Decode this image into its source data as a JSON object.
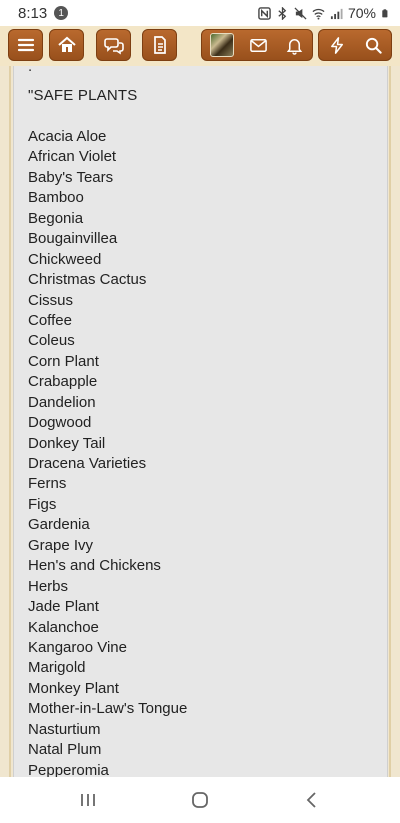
{
  "status_bar": {
    "time": "8:13",
    "notification_count": "1",
    "battery_percent": "70%",
    "icons": [
      "nfc-icon",
      "bluetooth-icon",
      "mute-icon",
      "wifi-icon",
      "signal-icon",
      "battery-icon"
    ]
  },
  "toolbar": {
    "left_buttons": [
      "menu-icon",
      "home-icon",
      "chat-icon",
      "document-icon"
    ],
    "right_buttons": [
      "avatar",
      "mail-icon",
      "bell-icon",
      "lightning-icon",
      "search-icon"
    ],
    "accent_color": "#a85b24",
    "background_color": "#f3e6c7"
  },
  "post": {
    "heading": "\"SAFE PLANTS",
    "top_fragment": ".",
    "plants": [
      "Acacia Aloe",
      "African Violet",
      "Baby's Tears",
      "Bamboo",
      "Begonia",
      "Bougainvillea",
      "Chickweed",
      "Christmas Cactus",
      "Cissus",
      "Coffee",
      "Coleus",
      "Corn Plant",
      "Crabapple",
      "Dandelion",
      "Dogwood",
      "Donkey Tail",
      "Dracena Varieties",
      "Ferns",
      "Figs",
      "Gardenia",
      "Grape Ivy",
      "Hen's and Chickens",
      "Herbs",
      "Jade Plant",
      "Kalanchoe",
      "Kangaroo Vine",
      "Marigold",
      "Monkey Plant",
      "Mother-in-Law's Tongue",
      "Nasturtium",
      "Natal Plum",
      "Pepperomia"
    ]
  },
  "nav_bar": {
    "buttons": [
      "recent-apps-icon",
      "home-circle-icon",
      "back-icon"
    ]
  }
}
